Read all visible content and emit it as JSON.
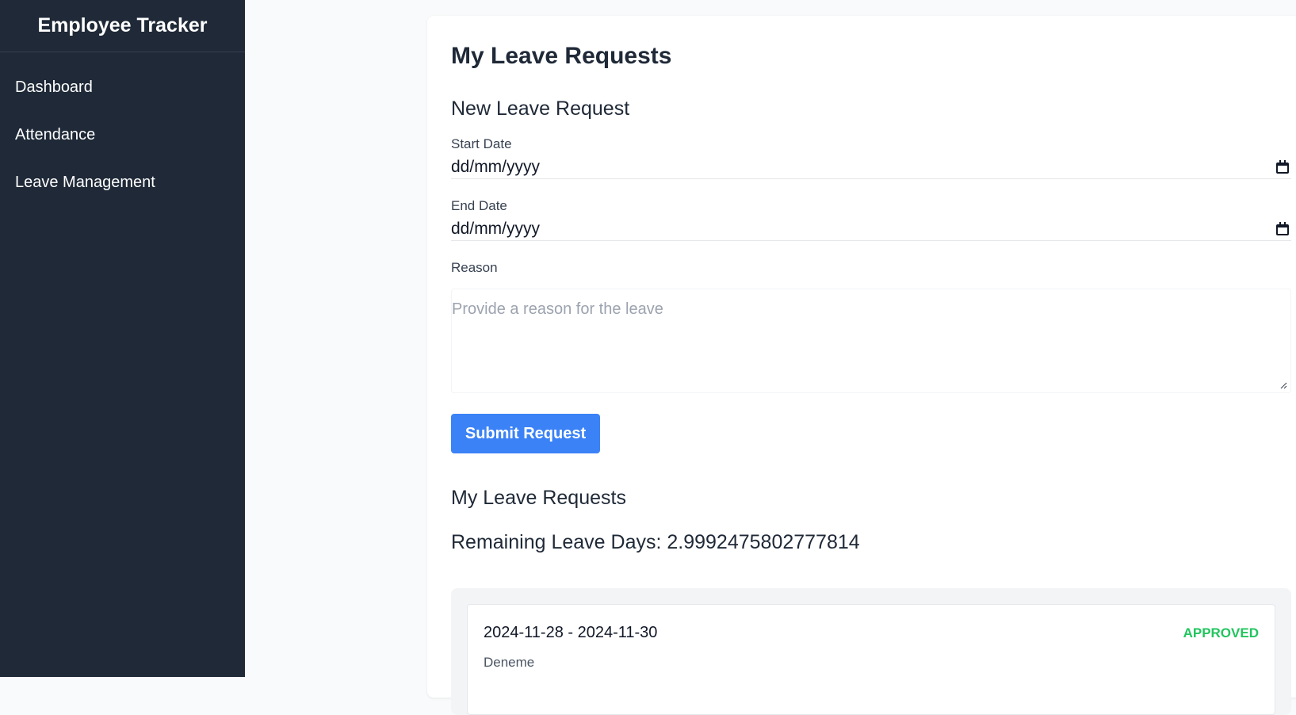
{
  "app": {
    "title": "Employee Tracker"
  },
  "sidebar": {
    "items": [
      {
        "label": "Dashboard"
      },
      {
        "label": "Attendance"
      },
      {
        "label": "Leave Management"
      }
    ]
  },
  "main": {
    "page_title": "My Leave Requests",
    "form": {
      "title": "New Leave Request",
      "start_date": {
        "label": "Start Date",
        "value": "dd/mm/yyyy"
      },
      "end_date": {
        "label": "End Date",
        "value": "dd/mm/yyyy"
      },
      "reason": {
        "label": "Reason",
        "placeholder": "Provide a reason for the leave"
      },
      "submit_label": "Submit Request"
    },
    "requests": {
      "title": "My Leave Requests",
      "remaining_label": "Remaining Leave Days: 2.9992475802777814",
      "items": [
        {
          "dates": "2024-11-28 - 2024-11-30",
          "status": "APPROVED",
          "reason": "Deneme"
        }
      ]
    }
  },
  "colors": {
    "sidebar_bg": "#1f2937",
    "primary": "#3b82f6",
    "approved": "#22c55e"
  }
}
